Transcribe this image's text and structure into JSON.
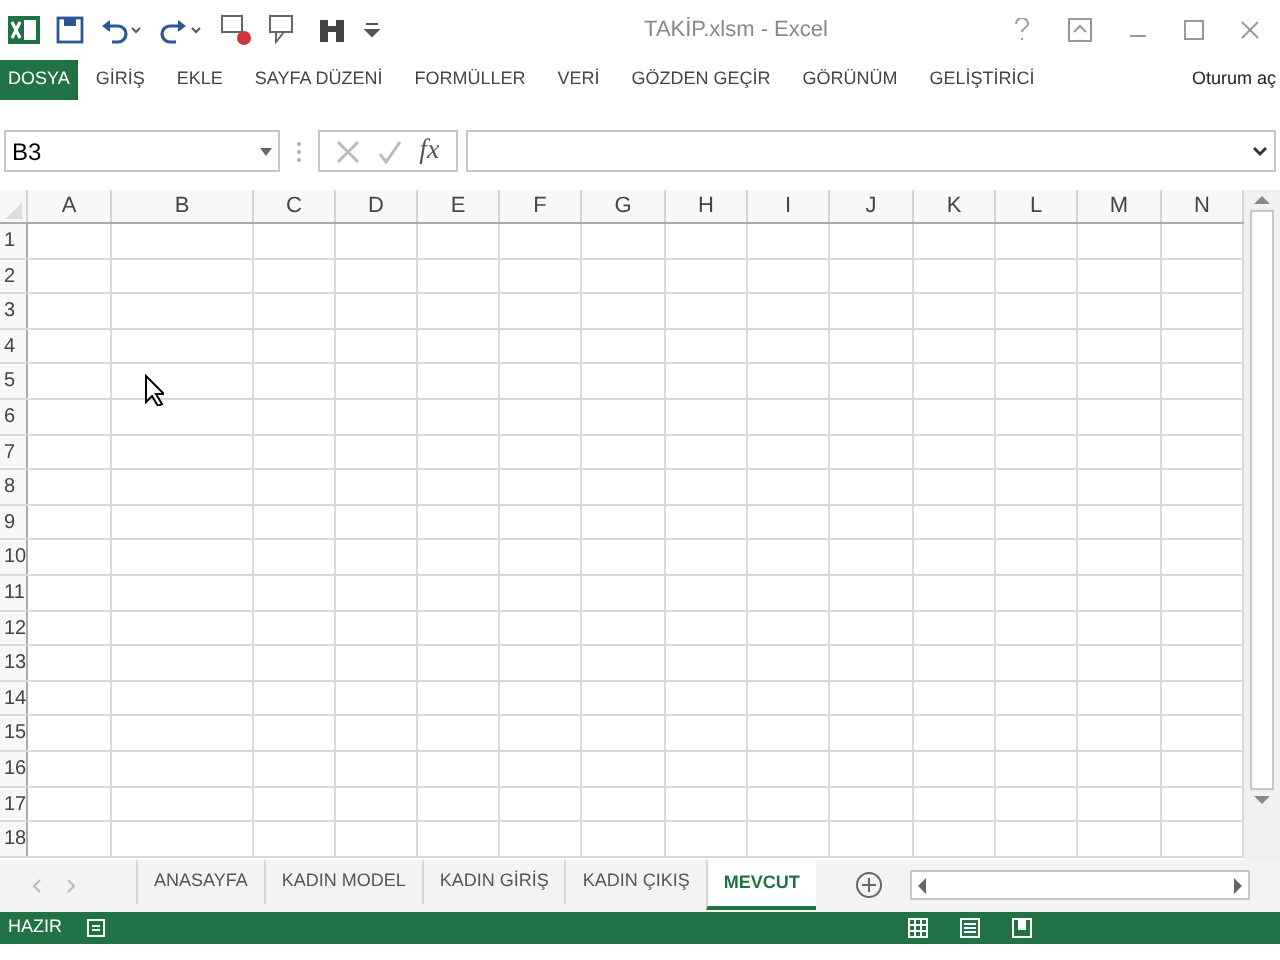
{
  "window": {
    "title": "TAKİP.xlsm - Excel"
  },
  "ribbon": {
    "file_tab": "DOSYA",
    "tabs": [
      {
        "label": "GİRİŞ",
        "selected": false
      },
      {
        "label": "EKLE",
        "selected": false
      },
      {
        "label": "SAYFA DÜZENİ",
        "selected": false
      },
      {
        "label": "FORMÜLLER",
        "selected": false
      },
      {
        "label": "VERİ",
        "selected": false
      },
      {
        "label": "GÖZDEN GEÇİR",
        "selected": false
      },
      {
        "label": "GÖRÜNÜM",
        "selected": false
      },
      {
        "label": "GELİŞTİRİCİ",
        "selected": false
      }
    ],
    "sign_in": "Oturum aç"
  },
  "formula_bar": {
    "name_box": "B3",
    "fx": "fx"
  },
  "sheet": {
    "columns": [
      "A",
      "B",
      "C",
      "D",
      "E",
      "F",
      "G",
      "H",
      "I",
      "J",
      "K",
      "L",
      "M",
      "N"
    ],
    "rows": [
      "1",
      "2",
      "3",
      "4",
      "5",
      "6",
      "7",
      "8",
      "9",
      "10",
      "11",
      "12",
      "13",
      "14",
      "15",
      "16",
      "17",
      "18"
    ]
  },
  "sheet_tabs": [
    {
      "label": "ANASAYFA",
      "selected": false
    },
    {
      "label": "KADIN MODEL",
      "selected": false
    },
    {
      "label": "KADIN GİRİŞ",
      "selected": false
    },
    {
      "label": "KADIN ÇIKIŞ",
      "selected": false
    },
    {
      "label": "MEVCUT",
      "selected": true
    }
  ],
  "status_bar": {
    "status": "HAZIR"
  }
}
